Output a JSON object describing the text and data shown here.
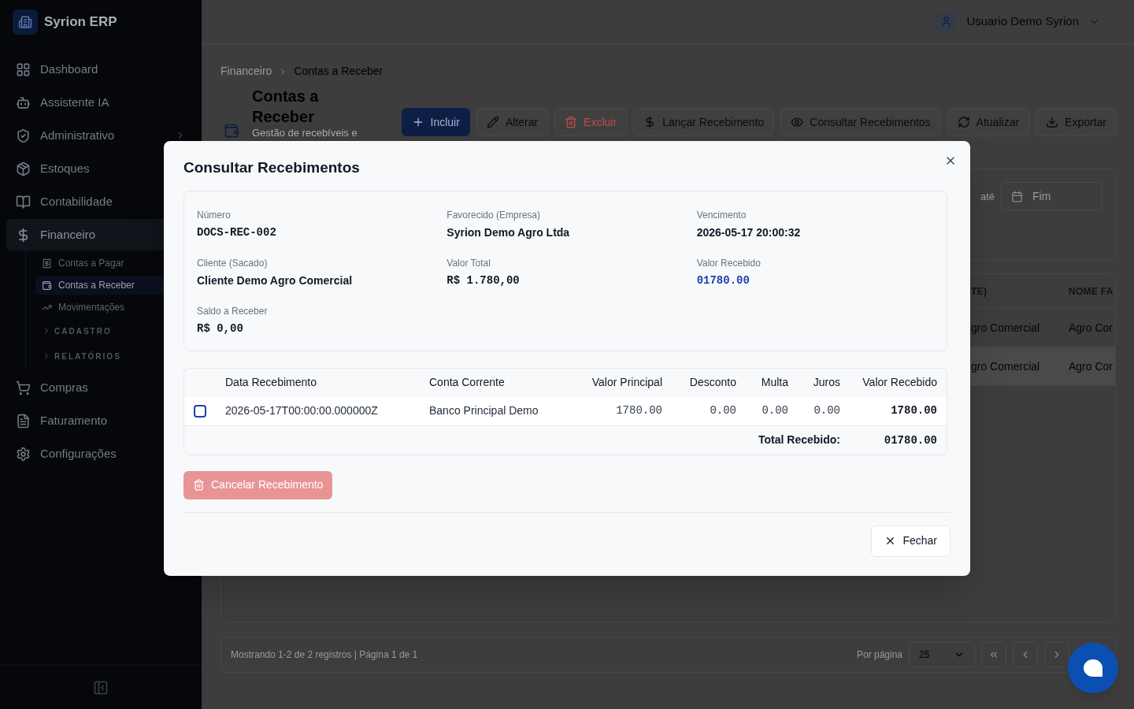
{
  "app": {
    "brand": "Syrion ERP",
    "user": "Usuario Demo Syrion"
  },
  "sidebar": {
    "items": [
      {
        "label": "Dashboard",
        "selected": false
      },
      {
        "label": "Assistente IA",
        "selected": false
      },
      {
        "label": "Administrativo",
        "selected": false,
        "expanded": false
      },
      {
        "label": "Estoques",
        "selected": false
      },
      {
        "label": "Contabilidade",
        "selected": false
      },
      {
        "label": "Financeiro",
        "selected": true,
        "expanded": true,
        "children": [
          {
            "kind": "link",
            "label": "Contas a Pagar",
            "selected": false
          },
          {
            "kind": "link",
            "label": "Contas a Receber",
            "selected": true
          },
          {
            "kind": "link",
            "label": "Movimentações",
            "selected": false
          },
          {
            "kind": "section",
            "label": "CADASTRO",
            "expanded": false
          },
          {
            "kind": "section",
            "label": "RELATÓRIOS",
            "expanded": false
          }
        ]
      },
      {
        "label": "Compras",
        "selected": false
      },
      {
        "label": "Faturamento",
        "selected": false
      },
      {
        "label": "Configurações",
        "selected": false
      }
    ]
  },
  "breadcrumb": [
    "Financeiro",
    "Contas a Receber"
  ],
  "page": {
    "title": "Contas a Receber",
    "subtitle": "Gestão de recebíveis e"
  },
  "toolbar": [
    {
      "label": "Incluir",
      "kind": "primary"
    },
    {
      "label": "Alterar",
      "kind": "default"
    },
    {
      "label": "Excluir",
      "kind": "danger"
    },
    {
      "label": "Lançar Recebimento",
      "kind": "default"
    },
    {
      "label": "Consultar Recebimentos",
      "kind": "default"
    },
    {
      "label": "Atualizar",
      "kind": "default"
    },
    {
      "label": "Exportar",
      "kind": "default"
    }
  ],
  "filters": {
    "separator": "até",
    "end_placeholder": "Fim"
  },
  "table": {
    "columns": [
      "TE)",
      "NOME FA"
    ],
    "rows": [
      {
        "cells": [
          "gro Comercial",
          "Agro Cor"
        ],
        "selected": false
      },
      {
        "cells": [
          "gro Comercial",
          "Agro Cor"
        ],
        "selected": true
      }
    ]
  },
  "pagination": {
    "summary": "Mostrando 1-2 de 2 registros | Página 1 de 1",
    "per_page_label": "Por página",
    "per_page": "25"
  },
  "modal": {
    "title": "Consultar Recebimentos",
    "fields": [
      {
        "label": "Número",
        "value": "DOCS-REC-002",
        "kind": "mono"
      },
      {
        "label": "Favorecido (Empresa)",
        "value": "Syrion Demo Agro Ltda",
        "kind": "text"
      },
      {
        "label": "Vencimento",
        "value": "2026-05-17 20:00:32",
        "kind": "text"
      },
      {
        "label": "Cliente (Sacado)",
        "value": "Cliente Demo Agro Comercial",
        "kind": "text"
      },
      {
        "label": "Valor Total",
        "value": "R$ 1.780,00",
        "kind": "mono"
      },
      {
        "label": "Valor Recebido",
        "value": "01780.00",
        "kind": "highlight"
      },
      {
        "label": "Saldo a Receber",
        "value": "R$ 0,00",
        "kind": "mono"
      }
    ],
    "columns": [
      "Data Recebimento",
      "Conta Corrente",
      "Valor Principal",
      "Desconto",
      "Multa",
      "Juros",
      "Valor Recebido"
    ],
    "rows": [
      {
        "checked": false,
        "cells": [
          "2026-05-17T00:00:00.000000Z",
          "Banco Principal Demo",
          "1780.00",
          "0.00",
          "0.00",
          "0.00",
          "1780.00"
        ]
      }
    ],
    "total_label": "Total Recebido:",
    "total_value": "01780.00",
    "cancel_button": {
      "label": "Cancelar Recebimento",
      "disabled": true
    },
    "close_button": "Fechar"
  }
}
